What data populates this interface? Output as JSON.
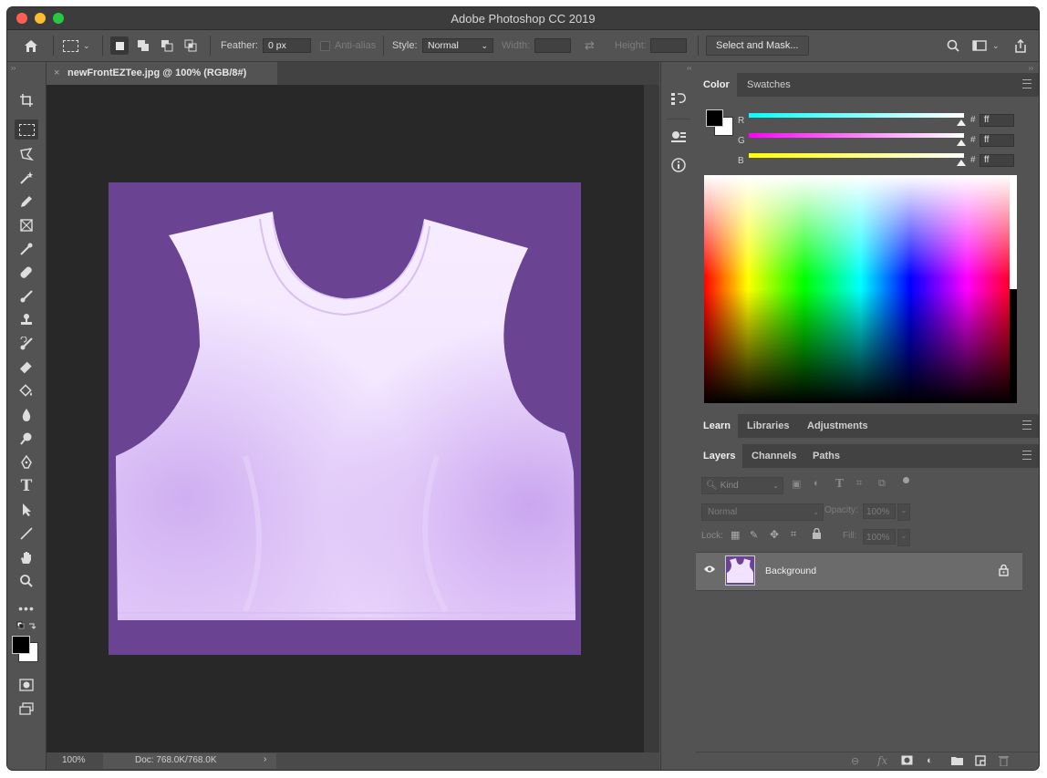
{
  "window": {
    "title": "Adobe Photoshop CC 2019",
    "traffic": {
      "close": "#fd5f57",
      "minimize": "#fdbb2e",
      "zoom": "#28c840"
    }
  },
  "options": {
    "feather_label": "Feather:",
    "feather_value": "0 px",
    "antialias_label": "Anti-alias",
    "style_label": "Style:",
    "style_value": "Normal",
    "width_label": "Width:",
    "height_label": "Height:",
    "select_mask_label": "Select and Mask..."
  },
  "document": {
    "tab_title": "newFrontEZTee.jpg @ 100% (RGB/8#)",
    "zoom": "100%",
    "doc_size": "Doc: 768.0K/768.0K",
    "canvas_bg": "#6b4393",
    "shirt_color": "#f4e8ff"
  },
  "color_panel": {
    "tabs": [
      "Color",
      "Swatches"
    ],
    "channels": [
      {
        "label": "R",
        "hex": "ff"
      },
      {
        "label": "G",
        "hex": "ff"
      },
      {
        "label": "B",
        "hex": "ff"
      }
    ],
    "foreground": "#000000",
    "background": "#ffffff"
  },
  "learn_panel": {
    "tabs": [
      "Learn",
      "Libraries",
      "Adjustments"
    ]
  },
  "layers_panel": {
    "tabs": [
      "Layers",
      "Channels",
      "Paths"
    ],
    "filter_placeholder": "Kind",
    "blend_mode": "Normal",
    "opacity_label": "Opacity:",
    "opacity_value": "100%",
    "lock_label": "Lock:",
    "fill_label": "Fill:",
    "fill_value": "100%",
    "layers": [
      {
        "name": "Background",
        "visible": true,
        "locked": true
      }
    ]
  }
}
